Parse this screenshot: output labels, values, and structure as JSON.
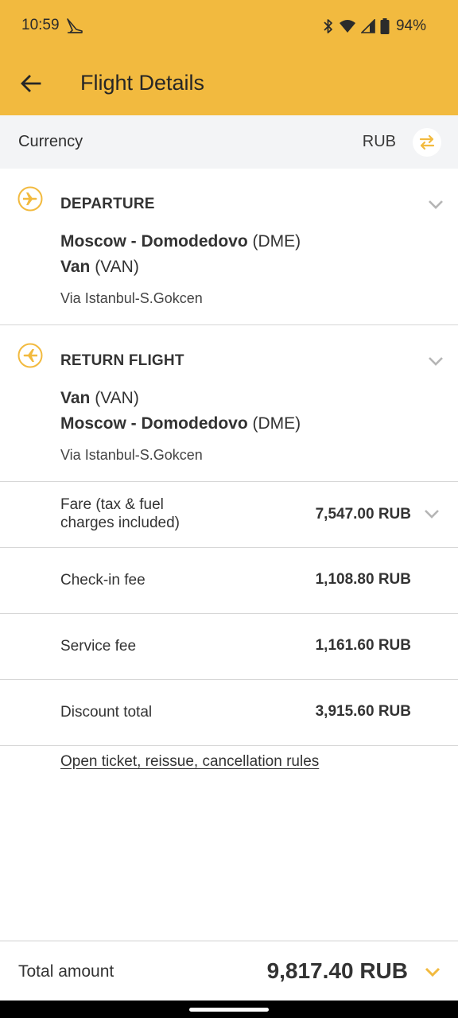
{
  "status_bar": {
    "time": "10:59",
    "battery": "94%"
  },
  "toolbar": {
    "title": "Flight Details"
  },
  "currency": {
    "label": "Currency",
    "value": "RUB"
  },
  "departure": {
    "title": "DEPARTURE",
    "from_city": "Moscow - Domodedovo",
    "from_code": "(DME)",
    "to_city": "Van",
    "to_code": "(VAN)",
    "via": "Via Istanbul-S.Gokcen"
  },
  "return_flight": {
    "title": "RETURN FLIGHT",
    "from_city": "Van",
    "from_code": "(VAN)",
    "to_city": "Moscow - Domodedovo",
    "to_code": "(DME)",
    "via": "Via Istanbul-S.Gokcen"
  },
  "fees": {
    "fare_label_line1": "Fare (tax & fuel",
    "fare_label_line2": "charges included)",
    "fare_value": "7,547.00 RUB",
    "checkin_label": "Check-in fee",
    "checkin_value": "1,108.80 RUB",
    "service_label": "Service fee",
    "service_value": "1,161.60 RUB",
    "discount_label": "Discount total",
    "discount_value": "3,915.60 RUB"
  },
  "rules_link": "Open ticket, reissue, cancellation rules",
  "total": {
    "label": "Total amount",
    "value": "9,817.40 RUB"
  },
  "colors": {
    "accent": "#f2ba3f",
    "currency_bg": "#f3f4f6",
    "text": "#333333"
  },
  "icons": {
    "back": "arrow-left-icon",
    "swap": "swap-arrows-icon",
    "departure": "plane-right-icon",
    "return": "plane-left-icon",
    "expand": "chevron-down-icon"
  }
}
